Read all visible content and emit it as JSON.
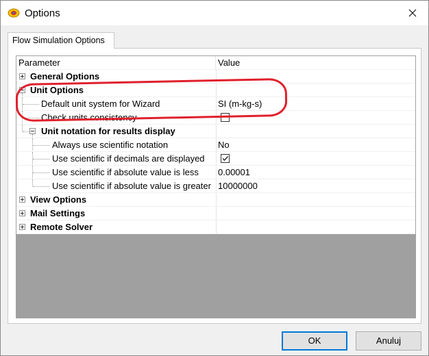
{
  "window": {
    "title": "Options"
  },
  "tabs": [
    {
      "label": "Flow Simulation Options"
    }
  ],
  "grid": {
    "header": {
      "parameter": "Parameter",
      "value": "Value"
    },
    "rows": [
      {
        "label": "General Options",
        "value": ""
      },
      {
        "label": "Unit Options",
        "value": ""
      },
      {
        "label": "Default unit system for Wizard",
        "value": "SI (m-kg-s)"
      },
      {
        "label": "Check units consistency",
        "value": "",
        "checked": false
      },
      {
        "label": "Unit notation for results display",
        "value": ""
      },
      {
        "label": "Always use scientific notation",
        "value": "No"
      },
      {
        "label": "Use scientific if decimals are displayed",
        "value": "",
        "checked": true
      },
      {
        "label": "Use scientific if absolute value is less",
        "value": "0.00001"
      },
      {
        "label": "Use scientific if absolute value is greater",
        "value": "10000000"
      },
      {
        "label": "View Options",
        "value": ""
      },
      {
        "label": "Mail Settings",
        "value": ""
      },
      {
        "label": "Remote Solver",
        "value": ""
      }
    ]
  },
  "buttons": {
    "ok": "OK",
    "cancel": "Anuluj"
  },
  "colors": {
    "highlight": "#e0202c",
    "ok_border": "#0078d7",
    "empty_area": "#a0a0a0"
  }
}
